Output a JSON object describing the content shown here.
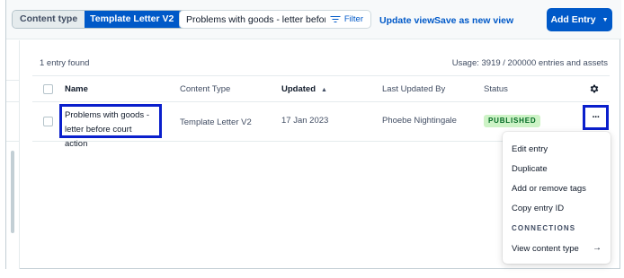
{
  "toolbar": {
    "content_type_label": "Content type",
    "content_type_value": "Template Letter V2",
    "search_value": "Problems with goods - letter before c",
    "filter_label": "Filter",
    "update_view_label": "Update view",
    "save_view_label": "Save as new view",
    "add_entry_label": "Add Entry"
  },
  "summary": {
    "entries_found": "1 entry found",
    "usage": "Usage: 3919 / 200000 entries and assets"
  },
  "table": {
    "columns": [
      "Name",
      "Content Type",
      "Updated",
      "Last Updated By",
      "Status"
    ],
    "rows": [
      {
        "name": "Problems with goods - letter before court action",
        "content_type": "Template Letter V2",
        "updated": "17 Jan 2023",
        "last_updated_by": "Phoebe Nightingale",
        "status": "PUBLISHED"
      }
    ]
  },
  "context_menu": {
    "items": [
      "Edit entry",
      "Duplicate",
      "Add or remove tags",
      "Copy entry ID"
    ],
    "section": "CONNECTIONS",
    "view_content_type": "View content type"
  },
  "colors": {
    "primary": "#0059c8",
    "highlight_outline": "#0a1fcc",
    "published_bg": "#cdf3c6",
    "published_text": "#006a23"
  },
  "icons": [
    "caret-down-icon",
    "filter-icon",
    "sort-ascending-icon",
    "gear-icon",
    "more-horizontal-icon",
    "arrow-right-icon"
  ]
}
